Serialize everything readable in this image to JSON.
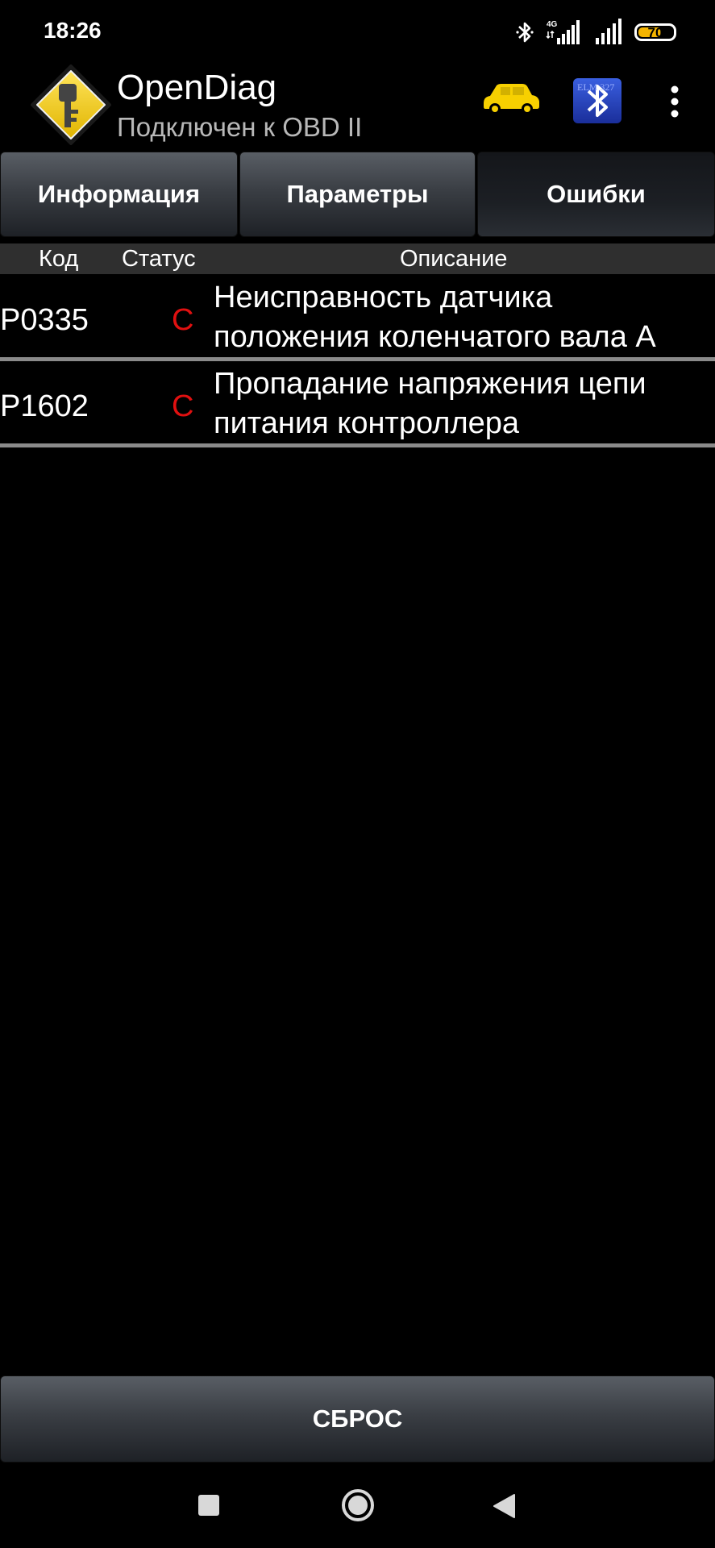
{
  "status_bar": {
    "time": "18:26",
    "network_label": "4G",
    "battery_level": "70",
    "battery_percent": 70,
    "icons": [
      "bluetooth-icon",
      "signal-4g-icon",
      "signal-icon",
      "battery-icon"
    ]
  },
  "app_bar": {
    "title": "OpenDiag",
    "subtitle": "Подключен к OBD II",
    "logo_icon": "key-diamond-logo",
    "car_icon": "car-icon",
    "connection_icon": "bluetooth-elm327-icon",
    "elm_label": "ELM 327",
    "menu_icon": "more-vertical-icon",
    "accent_color": "#f7d000"
  },
  "tabs": [
    {
      "label": "Информация",
      "active": false
    },
    {
      "label": "Параметры",
      "active": false
    },
    {
      "label": "Ошибки",
      "active": true
    }
  ],
  "table": {
    "columns": {
      "code": "Код",
      "status": "Статус",
      "description": "Описание"
    },
    "rows": [
      {
        "code": "P0335",
        "status": "C",
        "description": "Неисправность датчика положения коленчатого вала А"
      },
      {
        "code": "P1602",
        "status": "C",
        "description": "Пропадание напряжения цепи питания контроллера"
      }
    ],
    "status_color": "#e01010"
  },
  "actions": {
    "reset_label": "СБРОС"
  },
  "nav_bar": {
    "icons": [
      "recents-icon",
      "home-icon",
      "back-icon"
    ]
  }
}
